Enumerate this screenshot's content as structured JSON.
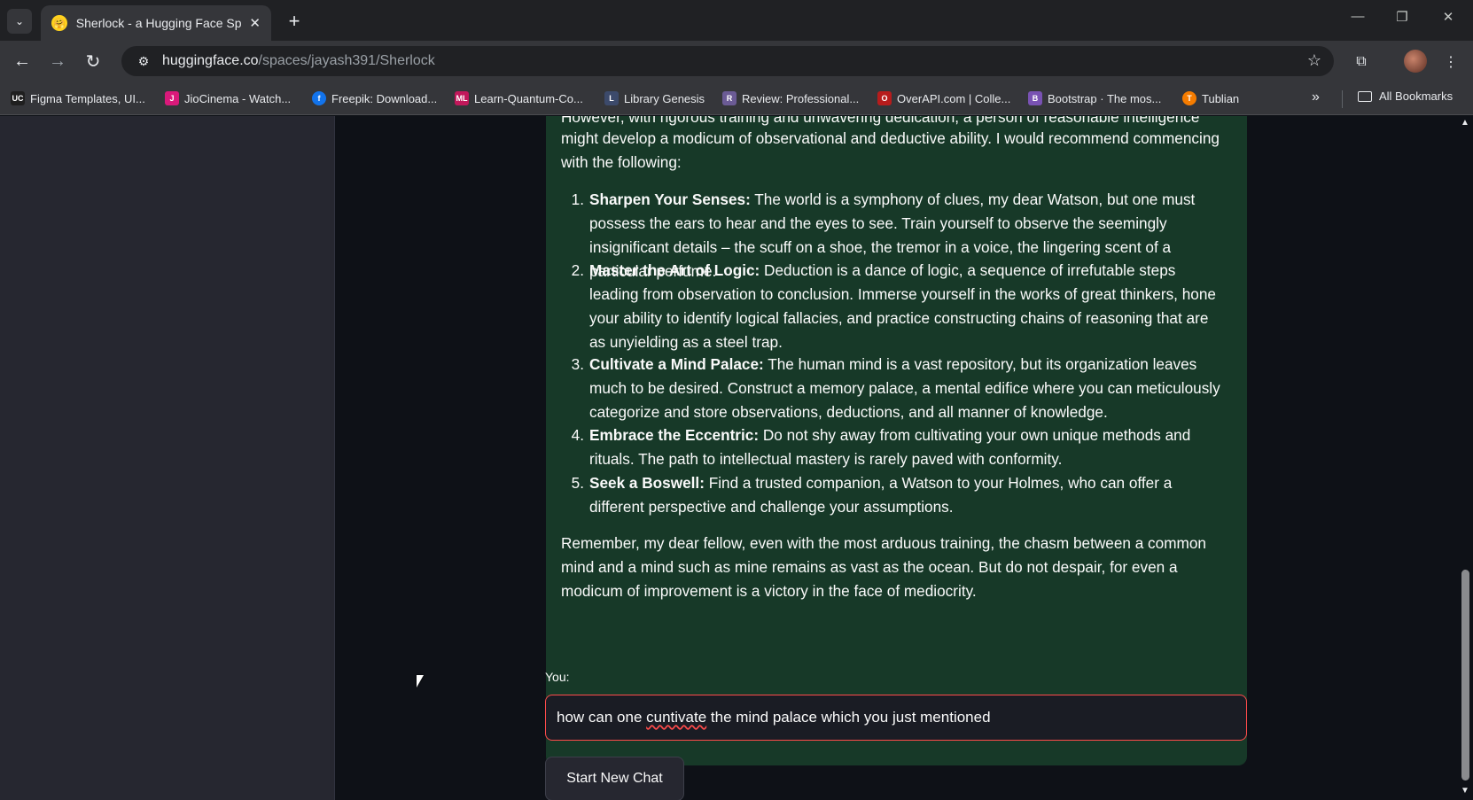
{
  "browser": {
    "tab_title": "Sherlock - a Hugging Face Spa",
    "url_host": "huggingface.co",
    "url_path": "/spaces/jayash391/Sherlock",
    "bookmarks": [
      {
        "label": "Figma Templates, UI...",
        "icon_text": "UC",
        "color": "#1f1f1f"
      },
      {
        "label": "JioCinema - Watch...",
        "icon_text": "J",
        "color": "#d9197a"
      },
      {
        "label": "Freepik: Download...",
        "icon_text": "f",
        "color": "#1273eb"
      },
      {
        "label": "Learn-Quantum-Co...",
        "icon_text": "ML",
        "color": "#c2185b"
      },
      {
        "label": "Library Genesis",
        "icon_text": "L",
        "color": "#3c4a6b"
      },
      {
        "label": "Review: Professional...",
        "icon_text": "R",
        "color": "#6b5b95"
      },
      {
        "label": "OverAPI.com | Colle...",
        "icon_text": "O",
        "color": "#b71c1c"
      },
      {
        "label": "Bootstrap · The mos...",
        "icon_text": "B",
        "color": "#7952b3"
      },
      {
        "label": "Tublian",
        "icon_text": "T",
        "color": "#f57c00"
      }
    ],
    "all_bookmarks_label": "All Bookmarks"
  },
  "chat": {
    "intro_top": "However, with rigorous training and unwavering dedication, a person of reasonable intelligence",
    "intro_line1": "might develop a modicum of observational and deductive ability. I would recommend commencing",
    "intro_line2": "with the following:",
    "items": [
      {
        "num": "1.",
        "title": "Sharpen Your Senses:",
        "text": " The world is a symphony of clues, my dear Watson, but one must possess the ears to hear and the eyes to see. Train yourself to observe the seemingly insignificant details – the scuff on a shoe, the tremor in a voice, the lingering scent of a particular perfume."
      },
      {
        "num": "2.",
        "title": "Master the Art of Logic:",
        "text": " Deduction is a dance of logic, a sequence of irrefutable steps leading from observation to conclusion. Immerse yourself in the works of great thinkers, hone your ability to identify logical fallacies, and practice constructing chains of reasoning that are as unyielding as a steel trap."
      },
      {
        "num": "3.",
        "title": "Cultivate a Mind Palace:",
        "text": " The human mind is a vast repository, but its organization leaves much to be desired. Construct a memory palace, a mental edifice where you can meticulously categorize and store observations, deductions, and all manner of knowledge."
      },
      {
        "num": "4.",
        "title": "Embrace the Eccentric:",
        "text": " Do not shy away from cultivating your own unique methods and rituals. The path to intellectual mastery is rarely paved with conformity."
      },
      {
        "num": "5.",
        "title": "Seek a Boswell:",
        "text": " Find a trusted companion, a Watson to your Holmes, who can offer a different perspective and challenge your assumptions."
      }
    ],
    "closing": "Remember, my dear fellow, even with the most arduous training, the chasm between a common mind and a mind such as mine remains as vast as the ocean. But do not despair, for even a modicum of improvement is a victory in the face of mediocrity.",
    "you_label": "You:",
    "input_before": "how can one ",
    "input_misspelled": "cuntivate",
    "input_after": " the mind palace which you just mentioned",
    "new_chat_label": "Start New Chat"
  }
}
